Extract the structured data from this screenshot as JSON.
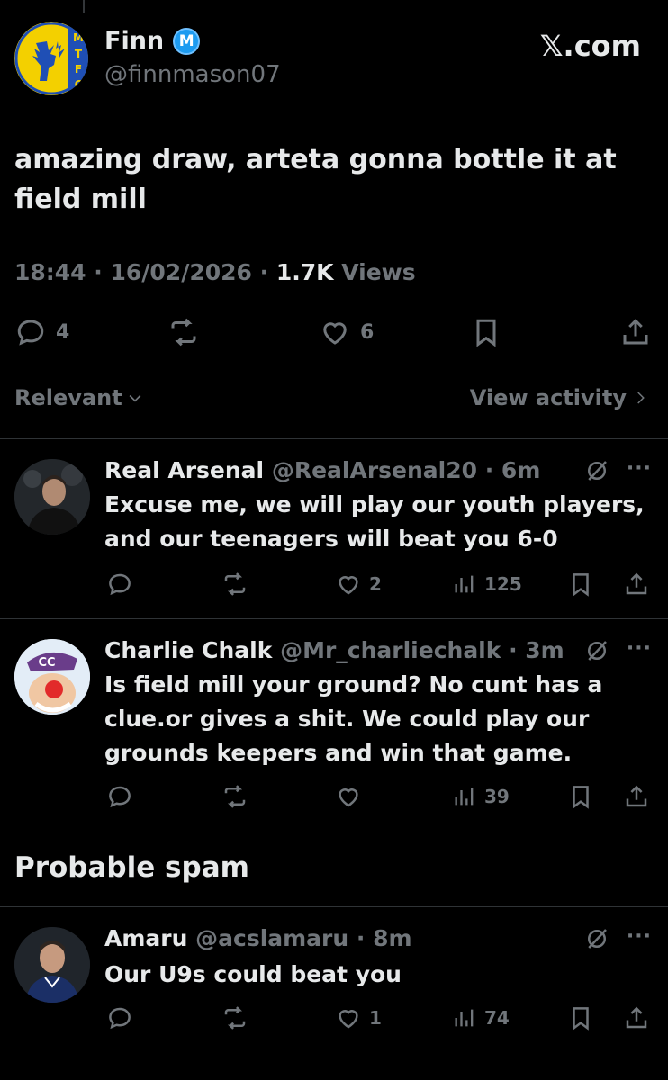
{
  "main": {
    "name": "Finn",
    "badge_letter": "M",
    "handle": "@finnmason07",
    "site": "𝕏.com",
    "text": "amazing draw, arteta gonna bottle it at field mill",
    "time": "18:44 · 16/02/2026 ·",
    "views_count": "1.7K",
    "views_label": "Views",
    "replies": "4",
    "likes": "6",
    "avatar_letters": [
      "M",
      "T",
      "F",
      "C"
    ]
  },
  "sort": {
    "relevant": "Relevant",
    "view_activity": "View activity"
  },
  "replies": [
    {
      "name": "Real Arsenal",
      "handle": "@RealArsenal20 · 6m",
      "text": "Excuse me, we will play our youth players, and our teenagers will beat you 6-0",
      "likes": "2",
      "views": "125"
    },
    {
      "name": "Charlie Chalk",
      "handle": "@Mr_charliechalk · 3m",
      "text": "Is field mill your ground? No cunt has a clue.or gives a shit. We could play our grounds keepers and win that game.",
      "likes": "",
      "views": "39",
      "avatar_label": "CC"
    }
  ],
  "spam_section": {
    "title": "Probable spam",
    "reply": {
      "name": "Amaru",
      "handle": "@acslamaru · 8m",
      "text": "Our U9s could beat you",
      "likes": "1",
      "views": "74"
    }
  },
  "more_label": "···",
  "colors": {
    "background": "#000000",
    "text": "#e7e9ea",
    "muted": "#71767b",
    "divider": "#2f3336",
    "verified": "#1d9bf0",
    "club_yellow": "#f3d000",
    "club_blue": "#1f4fb5"
  }
}
